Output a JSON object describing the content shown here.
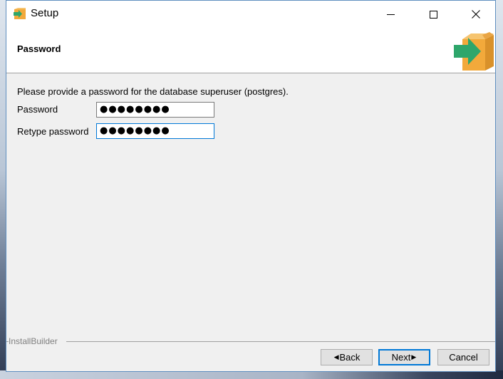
{
  "window": {
    "title": "Setup",
    "app_icon": "installer-box-arrow-icon",
    "controls": {
      "minimize": "minimize-icon",
      "maximize": "maximize-icon",
      "close": "close-icon"
    }
  },
  "header": {
    "title": "Password",
    "logo": "installer-box-arrow-icon"
  },
  "form": {
    "prompt": "Please provide a password for the database superuser (postgres).",
    "password": {
      "label": "Password",
      "masked_value": "●●●●●●●●"
    },
    "retype": {
      "label": "Retype password",
      "masked_value": "●●●●●●●●"
    }
  },
  "footer": {
    "brand": "InstallBuilder",
    "buttons": {
      "back": "Back",
      "next": "Next",
      "cancel": "Cancel"
    }
  },
  "colors": {
    "accent": "#0078d7",
    "box_orange": "#f2a93b",
    "arrow_green": "#2ea66b"
  }
}
